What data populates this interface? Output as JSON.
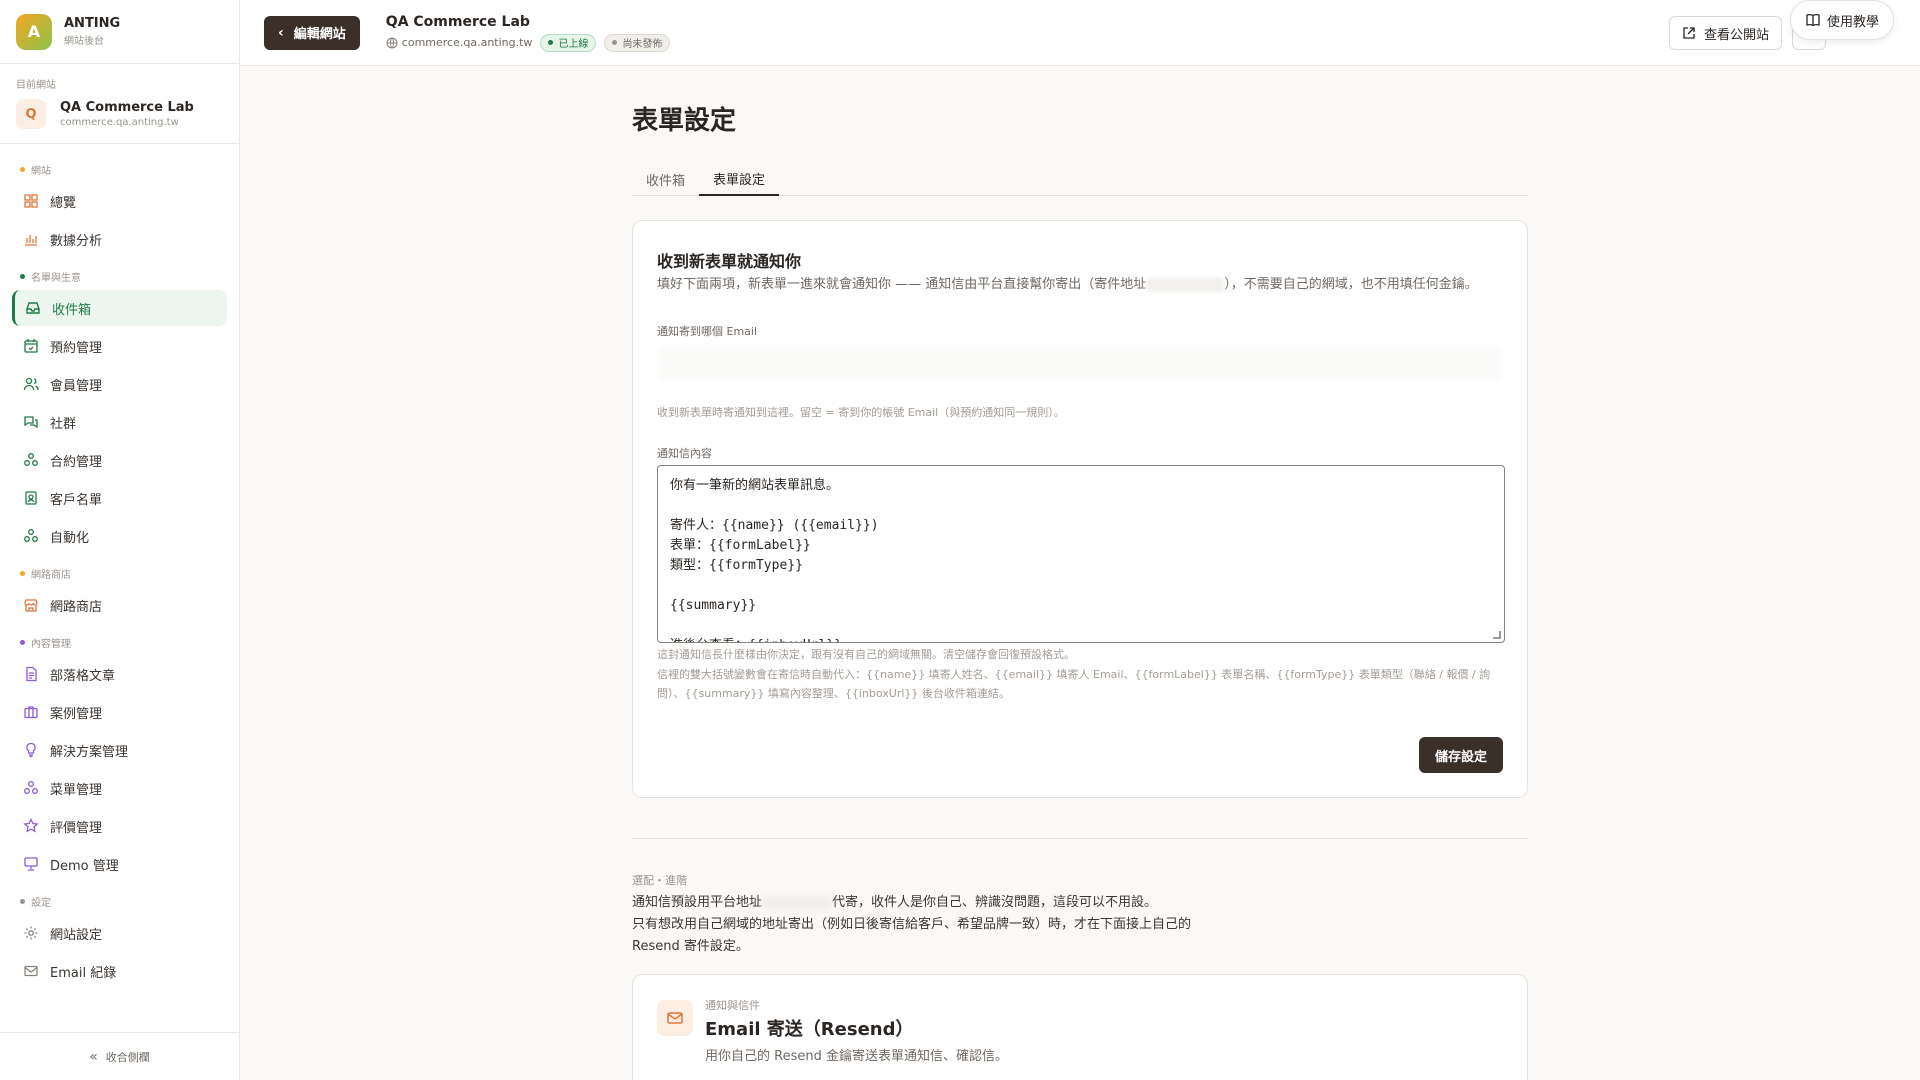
{
  "brand": {
    "logo_letter": "A",
    "name": "ANTING",
    "subtitle": "網站後台"
  },
  "current_site": {
    "label": "目前網站",
    "avatar_letter": "Q",
    "name": "QA Commerce Lab",
    "domain": "commerce.qa.anting.tw"
  },
  "nav": {
    "section_site": "網站",
    "overview": "總覽",
    "analytics": "數據分析",
    "section_crm": "名單與生意",
    "inbox": "收件箱",
    "booking": "預約管理",
    "members": "會員管理",
    "community": "社群",
    "contracts": "合約管理",
    "customers": "客戶名單",
    "automation": "自動化",
    "section_shop": "網路商店",
    "shop": "網路商店",
    "section_content": "內容管理",
    "blog": "部落格文章",
    "cases": "案例管理",
    "solutions": "解決方案管理",
    "menus": "菜單管理",
    "reviews": "評價管理",
    "demo": "Demo 管理",
    "section_settings": "設定",
    "site_settings": "網站設定",
    "email_log": "Email 紀錄",
    "collapse": "收合側欄"
  },
  "topbar": {
    "back_label": "編輯網站",
    "site_title": "QA Commerce Lab",
    "site_domain": "commerce.qa.anting.tw",
    "badge_live": "已上線",
    "badge_draft": "尚未發佈",
    "view_site": "查看公開站",
    "tutorial": "使用教學"
  },
  "page": {
    "title": "表單設定",
    "tabs": [
      "收件箱",
      "表單設定"
    ]
  },
  "notify_card": {
    "title": "收到新表單就通知你",
    "desc_part1": "填好下面兩項，新表單一進來就會通知你 —— 通知信由平台直接幫你寄出（寄件地址",
    "desc_part2": "），不需要自己的網域，也不用填任何金鑰。",
    "email_label": "通知寄到哪個 Email",
    "email_hint": "收到新表單時寄通知到這裡。留空 = 寄到你的帳號 Email（與預約通知同一規則）。",
    "body_label": "通知信內容",
    "body_value": "你有一筆新的網站表單訊息。\n\n寄件人：{{name}} ({{email}})\n表單：{{formLabel}}\n類型：{{formType}}\n\n{{summary}}\n\n進後台查看：{{inboxUrl}}",
    "body_hint1": "這封通知信長什麼樣由你決定，跟有沒有自己的網域無關。清空儲存會回復預設格式。",
    "body_hint2": "信裡的雙大括號變數會在寄信時自動代入：{{name}} 填寄人姓名、{{email}} 填寄人 Email、{{formLabel}} 表單名稱、{{formType}} 表單類型（聯絡 / 報價 / 詢問）、{{summary}} 填寫內容整理、{{inboxUrl}} 後台收件箱連結。",
    "save": "儲存設定"
  },
  "advanced": {
    "label": "選配・進階",
    "line1_a": "通知信預設用平台地址",
    "line1_b": "代寄，收件人是你自己、辨識沒問題，這段可以不用設。",
    "line2": "只有想改用自己網域的地址寄出（例如日後寄信給客戶、希望品牌一致）時，才在下面接上自己的 Resend 寄件設定。"
  },
  "resend_card": {
    "label": "通知與信件",
    "title": "Email 寄送（Resend）",
    "desc": "用你自己的 Resend 金鑰寄送表單通知信、確認信。"
  },
  "colors": {
    "accent_green": "#1f7a47",
    "dark_button": "#3b2f29",
    "orange": "#e0753a"
  }
}
